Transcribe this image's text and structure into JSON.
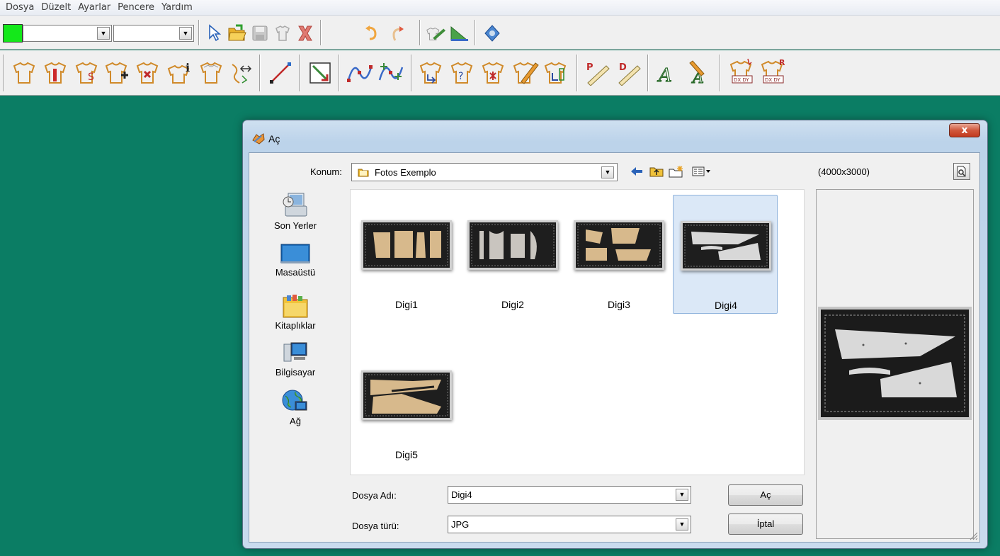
{
  "menu": [
    "Dosya",
    "Düzelt",
    "Ayarlar",
    "Pencere",
    "Yardım"
  ],
  "colors": {
    "workspace": "#0b7d64",
    "current_color": "#14e81a",
    "delete_red": "#d9302a",
    "close_red": "#c9492c"
  },
  "toolbar1": {
    "color_combo_value": "",
    "linetype_combo_value": "",
    "icons": [
      "arrow-pointer-icon",
      "open-folder-icon",
      "save-disk-icon",
      "garment-icon",
      "delete-x-icon",
      "undo-icon",
      "redo-icon",
      "digitize-icon",
      "triangle-ruler-icon",
      "help-icon"
    ]
  },
  "toolbar2": {
    "icons": [
      "garment-points-icon",
      "garment-sleeve-icon",
      "garment-s-icon",
      "garment-add-icon",
      "garment-remove-icon",
      "garment-info-icon",
      "garment-outline-icon",
      "garment-mirror-icon",
      "line-icon",
      "corner-icon",
      "curve-icon",
      "curve-points-icon",
      "garment-notch-icon",
      "garment-question-icon",
      "garment-cross-icon",
      "garment-pencil-icon",
      "garment-grade-icon",
      "ruler-p-icon",
      "ruler-d-icon",
      "text-a-icon",
      "text-brush-icon",
      "dxf-dy-icon",
      "dxf-dy-r-icon"
    ]
  },
  "dialog": {
    "title": "Aç",
    "close_label": "x",
    "location_label": "Konum:",
    "location_value": "Fotos Exemplo",
    "places": [
      {
        "label": "Son Yerler",
        "icon": "recent-places-icon"
      },
      {
        "label": "Masaüstü",
        "icon": "desktop-icon"
      },
      {
        "label": "Kitaplıklar",
        "icon": "libraries-icon"
      },
      {
        "label": "Bilgisayar",
        "icon": "computer-icon"
      },
      {
        "label": "Ağ",
        "icon": "network-icon"
      }
    ],
    "files": [
      {
        "name": "Digi1",
        "selected": false
      },
      {
        "name": "Digi2",
        "selected": false
      },
      {
        "name": "Digi3",
        "selected": false
      },
      {
        "name": "Digi4",
        "selected": true
      },
      {
        "name": "Digi5",
        "selected": false
      }
    ],
    "filename_label": "Dosya Adı:",
    "filename_value": "Digi4",
    "filetype_label": "Dosya türü:",
    "filetype_value": "JPG",
    "open_button": "Aç",
    "cancel_button": "İptal",
    "preview_size": "(4000x3000)"
  }
}
